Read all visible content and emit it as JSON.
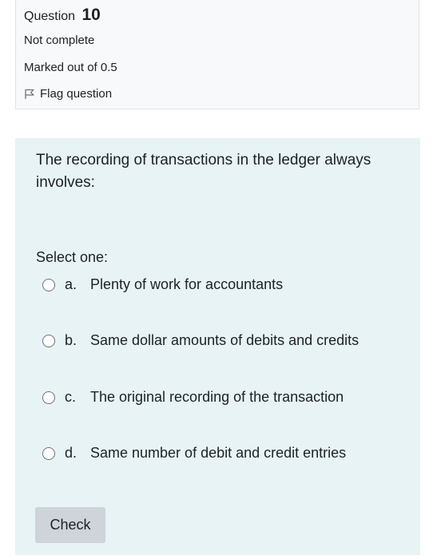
{
  "info": {
    "question_label": "Question",
    "question_number": "10",
    "state": "Not complete",
    "grade": "Marked out of 0.5",
    "flag_label": "Flag question"
  },
  "question": {
    "text": "The recording of transactions in the ledger always involves:",
    "prompt": "Select one:",
    "options": [
      {
        "letter": "a.",
        "label": "Plenty of work for accountants"
      },
      {
        "letter": "b.",
        "label": "Same dollar amounts of debits and credits"
      },
      {
        "letter": "c.",
        "label": "The original recording of the transaction"
      },
      {
        "letter": "d.",
        "label": "Same number of debit and credit entries"
      }
    ],
    "check_label": "Check"
  },
  "icons": {
    "flag": "flag-icon",
    "radio": "radio-unchecked-icon"
  },
  "colors": {
    "info_background": "#f8f9fa",
    "content_background": "#e7f3f5",
    "button_background": "#ced4da",
    "text": "#1d2125"
  }
}
